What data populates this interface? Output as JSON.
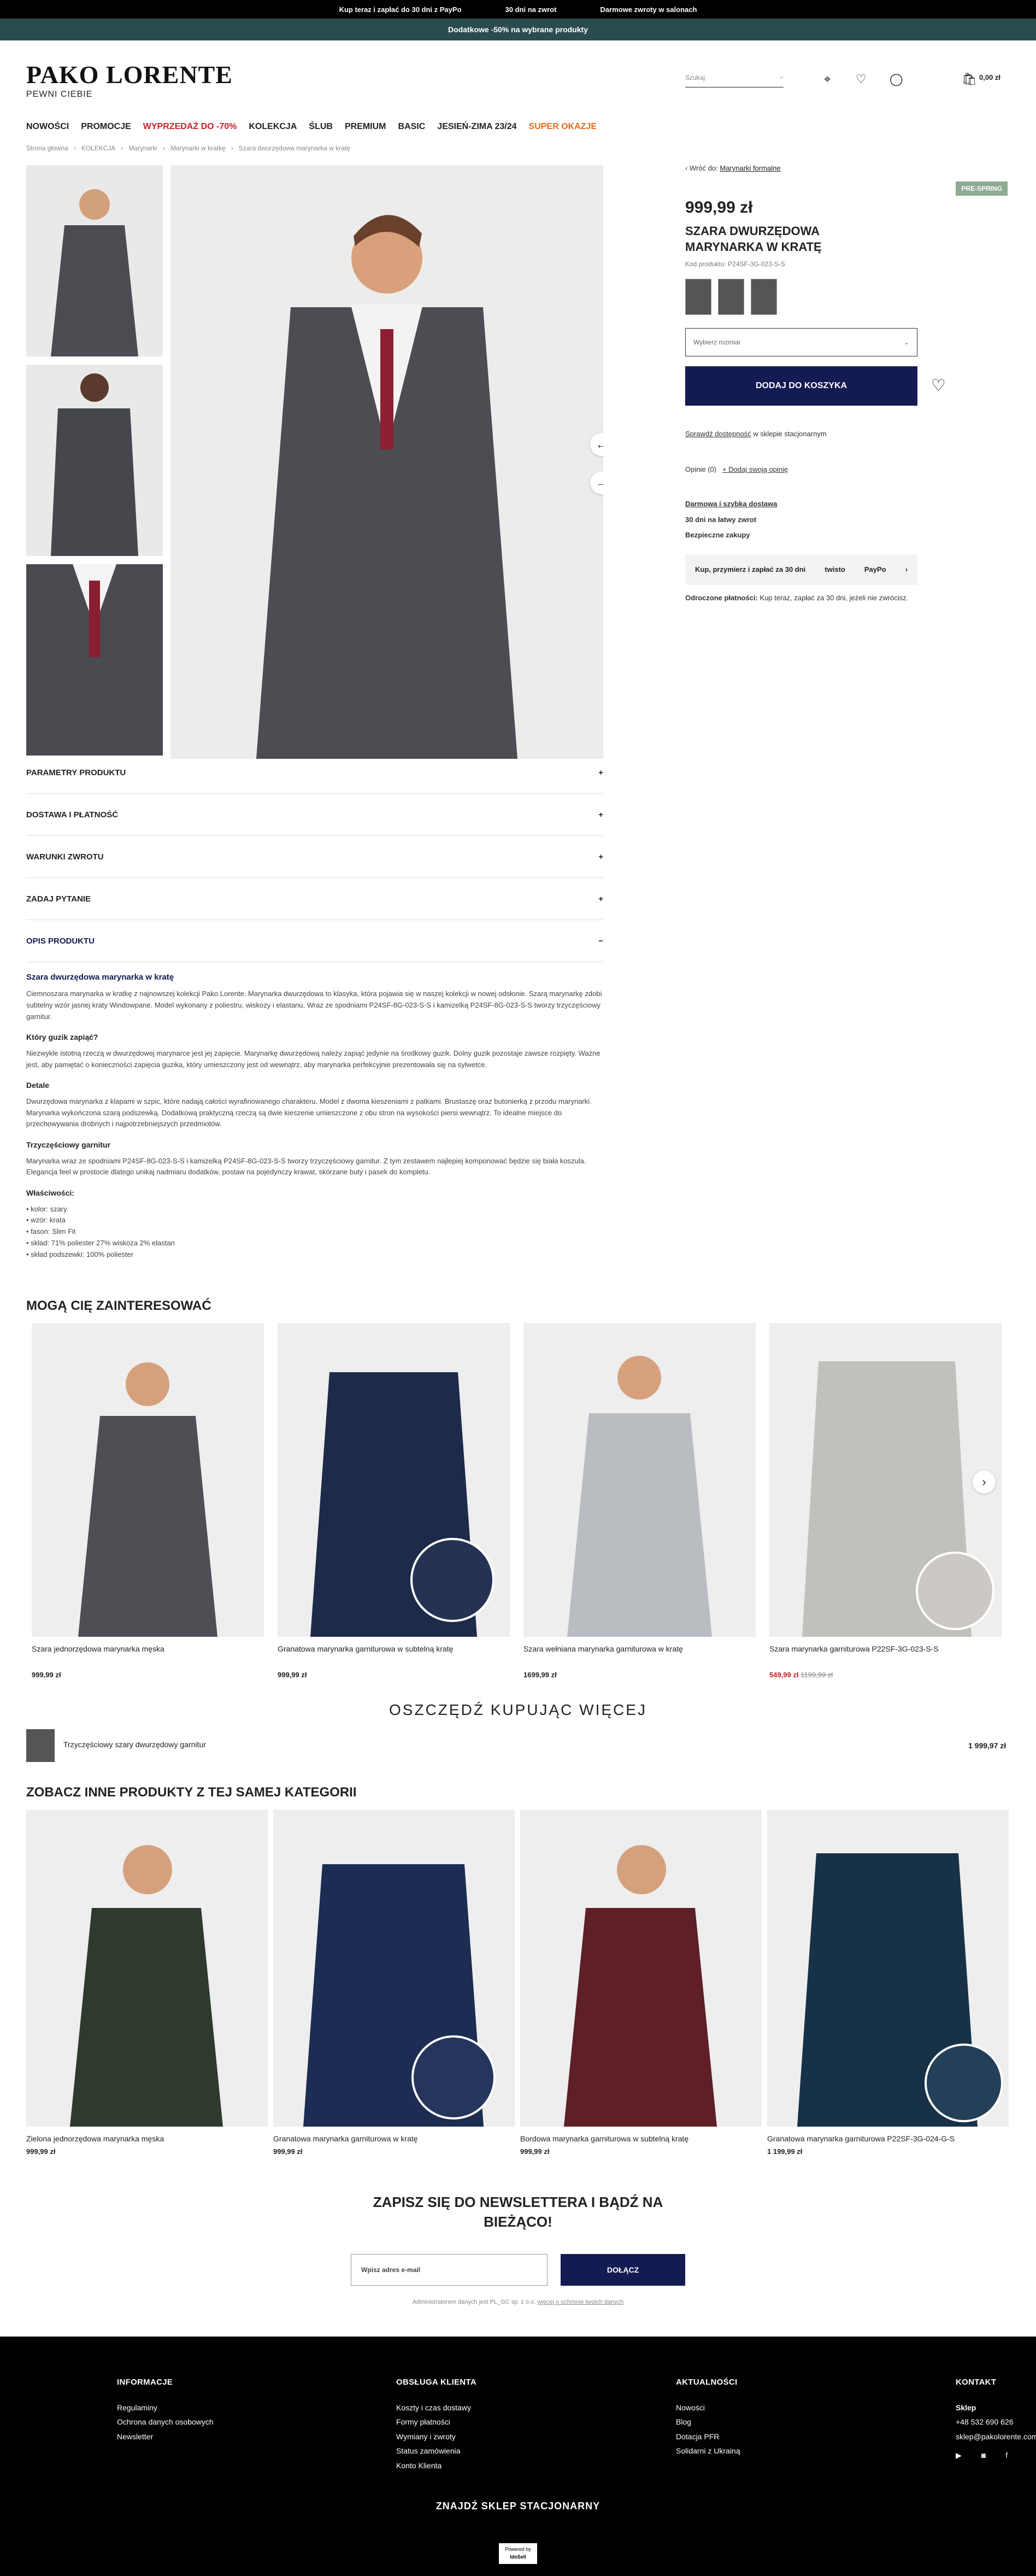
{
  "topbar": {
    "items": [
      "Kup teraz i zapłać do 30 dni z PayPo",
      "30 dni na zwrot",
      "Darmowe zwroty w salonach"
    ],
    "promo": "Dodatkowe -50% na wybrane produkty"
  },
  "header": {
    "logo": "PAKO LORENTE",
    "tagline": "PEWNI CIEBIE",
    "search_placeholder": "Szukaj",
    "cart_total": "0,00 zł"
  },
  "nav": [
    "NOWOŚCI",
    "PROMOCJE",
    "WYPRZEDAŻ DO -70%",
    "KOLEKCJA",
    "ŚLUB",
    "PREMIUM",
    "BASIC",
    "JESIEŃ-ZIMA 23/24",
    "SUPER OKAZJE"
  ],
  "breadcrumb": [
    "Strona główna",
    "KOLEKCJA",
    "Marynarki",
    "Marynarki w kratkę",
    "Szara dwurzędowa marynarka w kratę"
  ],
  "product": {
    "back": "Wróć do:",
    "back_link": "Marynarki formalne",
    "badge": "PRE-SPRING",
    "price": "999,99 zł",
    "name": "SZARA DWURZĘDOWA MARYNARKA W KRATĘ",
    "code": "Kod produktu: P24SF-3G-023-S-S",
    "size_placeholder": "Wybierz rozmiar",
    "add_to_cart": "DODAJ DO KOSZYKA",
    "availability_link": "Sprawdź dostępność",
    "availability_text": "w sklepie stacjonarnym",
    "opinions": "Opinie (0)",
    "add_opinion": "+ Dodaj swoją opinię",
    "delivery1": "Darmowa i szybka dostawa",
    "delivery2": "30 dni na łatwy zwrot",
    "delivery3": "Bezpieczne zakupy",
    "paypo_text": "Kup, przymierz i zapłać za 30 dni",
    "twisto": "twisto",
    "paypo": "PayPo",
    "deferred": "Odroczone płatności:",
    "deferred_text": "Kup teraz, zapłać za 30 dni, jeżeli nie zwrócisz."
  },
  "accordion": [
    "PARAMETRY PRODUKTU",
    "DOSTAWA I PŁATNOŚĆ",
    "WARUNKI ZWROTU",
    "ZADAJ PYTANIE",
    "OPIS PRODUKTU"
  ],
  "description": {
    "title": "Szara dwurzędowa marynarka w kratę",
    "p1": "Ciemnoszara marynarka w kratkę z najnowszej kolekcji Pako Lorente. Marynarka dwurzędowa to klasyka, która pojawia się w naszej kolekcji w nowej odsłonie. Szarą marynarkę zdobi subtelny wzór jasnej kraty Windowpane. Model wykonany z poliestru, wiskozy i elastanu. Wraz ze spodniami P24SF-8G-023-S-S i kamizelką P24SF-8G-023-S-S tworzy trzyczęściowy garnitur.",
    "h1": "Który guzik zapiąć?",
    "p2": "Niezwykle istotną rzeczą w dwurzędowej marynarce jest jej zapięcie. Marynarkę dwurzędową należy zapiąć jedynie na środkowy guzik. Dolny guzik pozostaje zawsze rozpięty. Ważne jest, aby pamiętać o konieczności zapięcia guzika, który umieszczony jest od wewnątrz, aby marynarka perfekcyjnie prezentowała się na sylwetce.",
    "h2": "Detale",
    "p3": "Dwurzędowa marynarka z klapami w szpic, które nadają całości wyrafinowanego charakteru. Model z dwoma kieszeniami z patkami. Brustaszę oraz butonierką z przodu marynarki. Marynarka wykończona szarą podszewką. Dodatkową praktyczną rzeczą są dwie kieszenie umieszczone z obu stron na wysokości piersi wewnątrz. To idealne miejsce do przechowywania drobnych i najpotrzebniejszych przedmiotów.",
    "h3": "Trzyczęściowy garnitur",
    "p4": "Marynarka wraz ze spodniami P24SF-8G-023-S-S i kamizelką P24SF-8G-023-S-S tworzy trzyczęściowy garnitur. Z tym zestawem najlepiej komponować będzie się biała koszula. Elegancja feel w prostocie dlatego unikaj nadmiaru dodatków, postaw na pojedynczy krawat, skórzane buty i pasek do kompletu.",
    "h4": "Właściwości:",
    "props": [
      "• kolor: szary",
      "• wzór: krata",
      "• fason: Slim Fit",
      "• skład: 71% poliester 27% wiskoza 2% elastan",
      "• skład podszewki: 100% poliester"
    ]
  },
  "interest": {
    "title": "MOGĄ CIĘ ZAINTERESOWAĆ",
    "items": [
      {
        "name": "Szara jednorzędowa marynarka męska",
        "price": "999,99 zł",
        "old": ""
      },
      {
        "name": "Granatowa marynarka garniturowa w subtelną kratę",
        "price": "999,99 zł",
        "old": ""
      },
      {
        "name": "Szara wełniana marynarka garniturowa w kratę",
        "price": "1699,99 zł",
        "old": ""
      },
      {
        "name": "Szara marynarka garniturowa P22SF-3G-023-S-S",
        "price": "549,99 zł",
        "old": "1199,99 zł"
      }
    ]
  },
  "save": {
    "title": "OSZCZĘDŹ KUPUJĄC WIĘCEJ",
    "item": "Trzyczęściowy szary dwurzędowy garnitur",
    "price": "1 999,97 zł"
  },
  "category": {
    "title": "ZOBACZ INNE PRODUKTY Z TEJ SAMEJ KATEGORII",
    "items": [
      {
        "name": "Zielona jednorzędowa marynarka męska",
        "price": "999,99 zł"
      },
      {
        "name": "Granatowa marynarka garniturowa w kratę",
        "price": "999,99 zł"
      },
      {
        "name": "Bordowa marynarka garniturowa w subtelną kratę",
        "price": "999,99 zł"
      },
      {
        "name": "Granatowa marynarka garniturowa P22SF-3G-024-G-S",
        "price": "1 199,99 zł"
      }
    ]
  },
  "newsletter": {
    "title1": "ZAPISZ SIĘ DO NEWSLETTERA I BĄDŹ NA",
    "title2": "BIEŻĄCO!",
    "placeholder": "Wpisz adres e-mail",
    "button": "DOŁĄCZ",
    "note": "Administratorem danych jest PL_GC sp. z o.o.",
    "note_link": "więcej o ochronie twoich danych"
  },
  "footer": {
    "info_title": "INFORMACJE",
    "info": [
      "Regulaminy",
      "Ochrona danych osobowych",
      "Newsletter"
    ],
    "service_title": "OBSŁUGA KLIENTA",
    "service": [
      "Koszty i czas dostawy",
      "Formy płatności",
      "Wymiany i zwroty",
      "Status zamówienia",
      "Konto Klienta"
    ],
    "news_title": "AKTUALNOŚCI",
    "news": [
      "Nowości",
      "Blog",
      "Dotacja PFR",
      "Solidarni z Ukrainą"
    ],
    "contact_title": "KONTAKT",
    "shop": "Sklep",
    "phone": "+48 532 690 626",
    "email": "sklep@pakolorente.com",
    "store_finder": "ZNAJDŹ SKLEP STACJONARNY",
    "powered": "Powered by",
    "brand": "IdoSell"
  }
}
